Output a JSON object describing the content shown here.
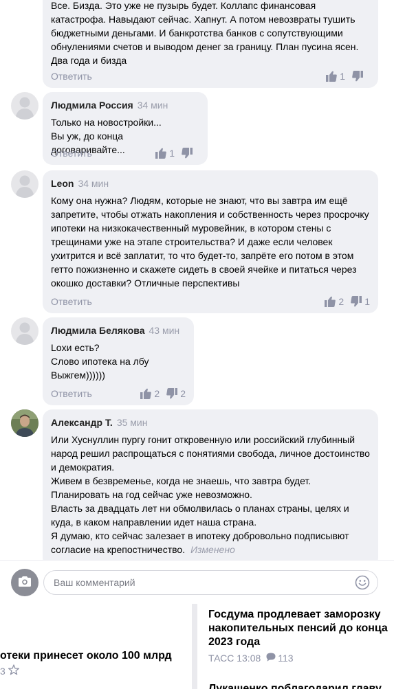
{
  "comments": [
    {
      "author": "",
      "time": "",
      "text": "Все. Бизда. Это уже не пузырь будет. Коллапс финансовая катастрофа. Навыдают сейчас. Хапнут. А потом невозвраты тушить бюджетными деньгами. И банкротства банков с сопутствующими обнулениями счетов и выводом денег за границу. План пусина ясен. Два года и бизда",
      "reply_label": "Ответить",
      "likes": "1",
      "dislikes": ""
    },
    {
      "author": "Людмила Россия",
      "time": "34 мин",
      "text": "Только на новостройки...\nВы уж, до конца договаривайте...",
      "reply_label": "Ответить",
      "likes": "1",
      "dislikes": ""
    },
    {
      "author": "Leon",
      "time": "34 мин",
      "text": "Кому она нужна? Людям, которые не знают, что вы завтра им ещё запретите, чтобы отжать накопления и собственность через просрочку ипотеки на низкокачественный муровейник, в котором стены с трещинами уже на этапе строительства? И даже если человек ухитрится и всё заплатит, то что будет-то, запрёте его потом в этом гетто пожизненно и скажете сидеть в своей ячейке и питаться через окошко доставки? Отличные перспективы",
      "reply_label": "Ответить",
      "likes": "2",
      "dislikes": "1"
    },
    {
      "author": "Людмила Белякова",
      "time": "43 мин",
      "text": "Loxи есть?\nСлово ипотека на лбу\nВыжгем))))))",
      "reply_label": "Ответить",
      "likes": "2",
      "dislikes": "2"
    },
    {
      "author": "Александр Т.",
      "time": "35 мин",
      "text": "Или Хуснуллин пургу гонит откровенную  или российский глубинный народ решил распрощаться с понятиями свобода, личное достоинство и демократия.\nЖивем в безвременье, когда не знаешь, что завтра будет.\nПланировать на год сейчас уже невозможно.\nВласть за двадцать лет ни обмолвилась о планах страны, целях и куда, в каком направлении идет наша страна.\nЯ думаю, кто сейчас залезает в ипотеку добровольно подписывют согласие на крепостничество.",
      "edited_label": "Изменено"
    }
  ],
  "composer": {
    "placeholder": "Ваш комментарий"
  },
  "news": {
    "left_title": "отеки принесет около 100 млрд",
    "left_meta": "3",
    "right_title": "Госдума продлевает заморозку накопительных пенсий до конца 2023 года",
    "right_source": "ТАСС 13:08",
    "right_comments": "113",
    "right_next_title": "Лукашенко поблагодарил главу"
  },
  "colors": {
    "bubble": "#eff0f4",
    "muted": "#8f93a6"
  }
}
